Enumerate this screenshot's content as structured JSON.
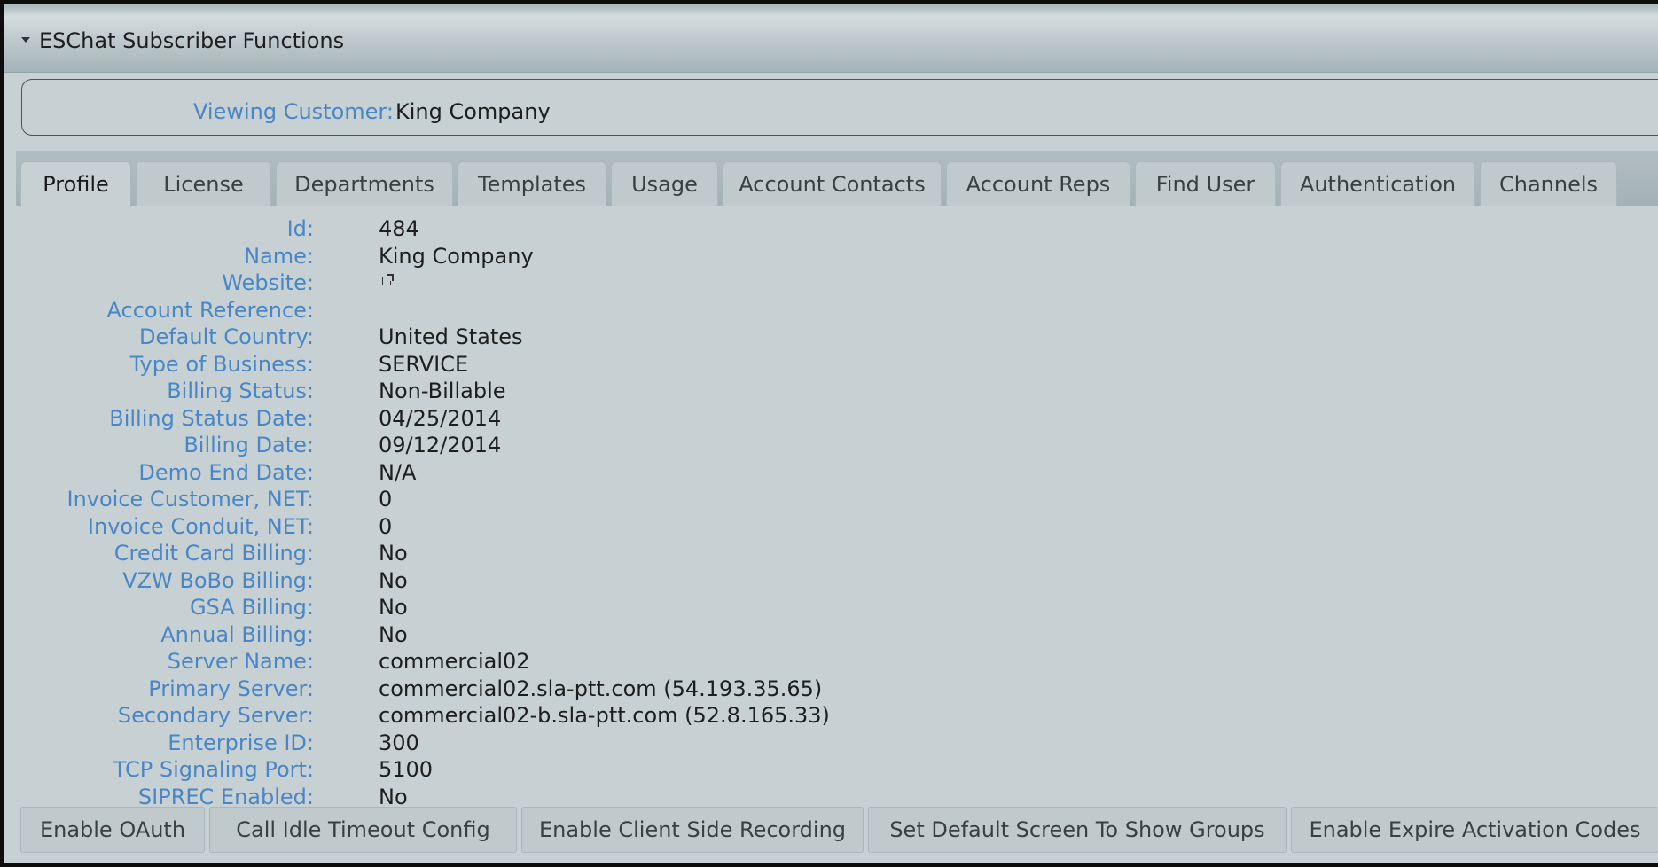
{
  "panel": {
    "title": "ESChat Subscriber Functions"
  },
  "customer": {
    "label": "Viewing Customer:",
    "value": "King Company"
  },
  "tabs": [
    {
      "label": "Profile"
    },
    {
      "label": "License"
    },
    {
      "label": "Departments"
    },
    {
      "label": "Templates"
    },
    {
      "label": "Usage"
    },
    {
      "label": "Account Contacts"
    },
    {
      "label": "Account Reps"
    },
    {
      "label": "Find User"
    },
    {
      "label": "Authentication"
    },
    {
      "label": "Channels"
    }
  ],
  "profile": [
    {
      "label": "Id:",
      "value": "484"
    },
    {
      "label": "Name:",
      "value": "King Company"
    },
    {
      "label": "Website:",
      "value": ""
    },
    {
      "label": "Account Reference:",
      "value": ""
    },
    {
      "label": "Default Country:",
      "value": "United States"
    },
    {
      "label": "Type of Business:",
      "value": "SERVICE"
    },
    {
      "label": "Billing Status:",
      "value": "Non-Billable"
    },
    {
      "label": "Billing Status Date:",
      "value": "04/25/2014"
    },
    {
      "label": "Billing Date:",
      "value": "09/12/2014"
    },
    {
      "label": "Demo End Date:",
      "value": "N/A"
    },
    {
      "label": "Invoice Customer, NET:",
      "value": "0"
    },
    {
      "label": "Invoice Conduit, NET:",
      "value": "0"
    },
    {
      "label": "Credit Card Billing:",
      "value": "No"
    },
    {
      "label": "VZW BoBo Billing:",
      "value": "No"
    },
    {
      "label": "GSA Billing:",
      "value": "No"
    },
    {
      "label": "Annual Billing:",
      "value": "No"
    },
    {
      "label": "Server Name:",
      "value": "commercial02"
    },
    {
      "label": "Primary Server:",
      "value": "commercial02.sla-ptt.com (54.193.35.65)"
    },
    {
      "label": "Secondary Server:",
      "value": "commercial02-b.sla-ptt.com (52.8.165.33)"
    },
    {
      "label": "Enterprise ID:",
      "value": "300"
    },
    {
      "label": "TCP Signaling Port:",
      "value": "5100"
    },
    {
      "label": "SIPREC Enabled:",
      "value": "No"
    }
  ],
  "actions": [
    {
      "label": "Enable OAuth"
    },
    {
      "label": "Call Idle Timeout Config"
    },
    {
      "label": "Enable Client Side Recording"
    },
    {
      "label": "Set Default Screen To Show Groups"
    },
    {
      "label": "Enable Expire Activation Codes"
    }
  ],
  "icons": {
    "collapse": "triangle-down-icon",
    "website": "external-link-icon"
  }
}
